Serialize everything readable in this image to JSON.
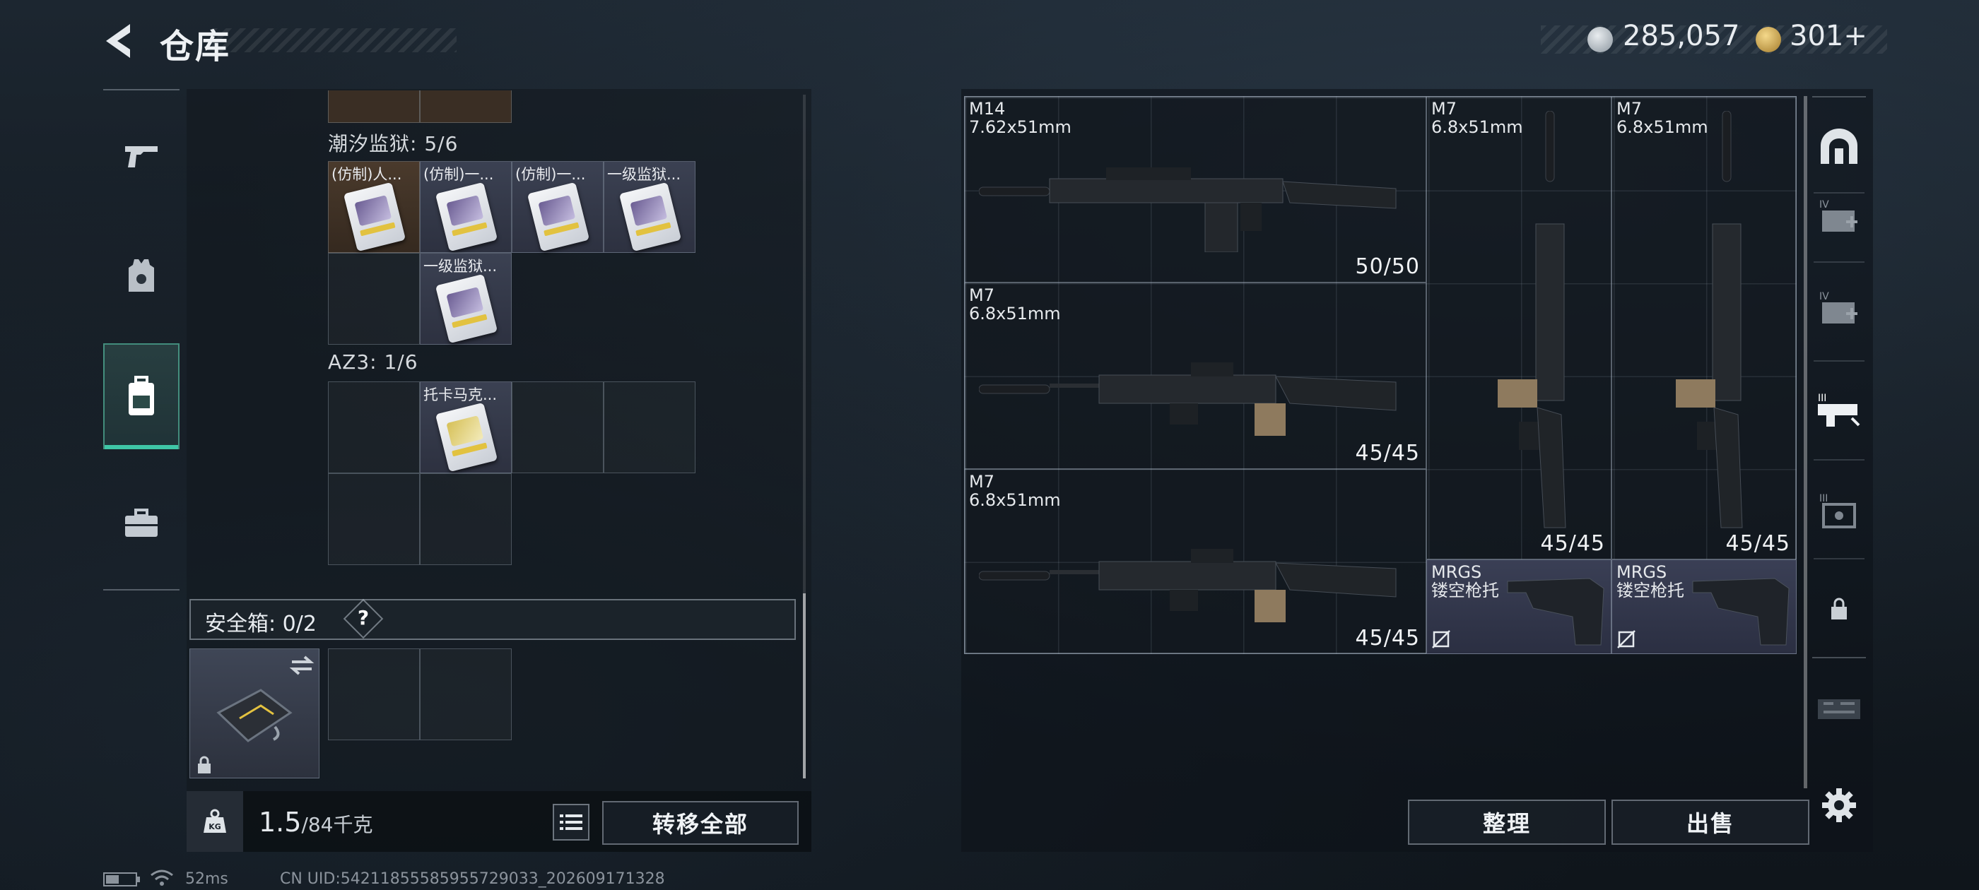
{
  "header": {
    "title": "仓库"
  },
  "currency": [
    {
      "value": "285,057",
      "icon": "silver-coin-icon",
      "color": "#c9d0d6"
    },
    {
      "value": "301+",
      "icon": "gold-coin-icon",
      "color": "#d9b45a"
    }
  ],
  "sidebar": {
    "items": [
      {
        "name": "weapon",
        "icon": "pistol-icon"
      },
      {
        "name": "armor",
        "icon": "armor-vest-icon"
      },
      {
        "name": "backpack",
        "icon": "backpack-icon",
        "active": true
      },
      {
        "name": "case",
        "icon": "briefcase-icon"
      }
    ],
    "accent": "#3fc6a6"
  },
  "left": {
    "section1": {
      "label": "潮汐监狱: 5/6",
      "items": [
        "(仿制)人...",
        "(仿制)一...",
        "(仿制)一...",
        "一级监狱...",
        "一级监狱..."
      ]
    },
    "section2": {
      "label": "AZ3: 1/6",
      "items": [
        "托卡马克..."
      ]
    },
    "safe": {
      "label": "安全箱: 0/2",
      "help": "?"
    },
    "weight": {
      "current": "1.5",
      "max": "/84千克",
      "icon_label": "KG"
    },
    "transfer_all": "转移全部"
  },
  "right": {
    "weapons": [
      {
        "name": "M14",
        "caliber": "7.62x51mm",
        "ammo": "50/50"
      },
      {
        "name": "M7",
        "caliber": "6.8x51mm",
        "ammo": "45/45"
      },
      {
        "name": "M7",
        "caliber": "6.8x51mm",
        "ammo": "45/45"
      },
      {
        "name": "M7",
        "caliber": "6.8x51mm",
        "ammo": "45/45"
      },
      {
        "name": "M7",
        "caliber": "6.8x51mm",
        "ammo": "45/45"
      }
    ],
    "stocks": [
      {
        "name": "MRGS",
        "sub": "镂空枪托"
      },
      {
        "name": "MRGS",
        "sub": "镂空枪托"
      }
    ],
    "sort_button": "整理",
    "sell_button": "出售"
  },
  "status_bar": {
    "ping": "52ms",
    "uid": "CN UID:54211855585955729033_202609171328"
  }
}
